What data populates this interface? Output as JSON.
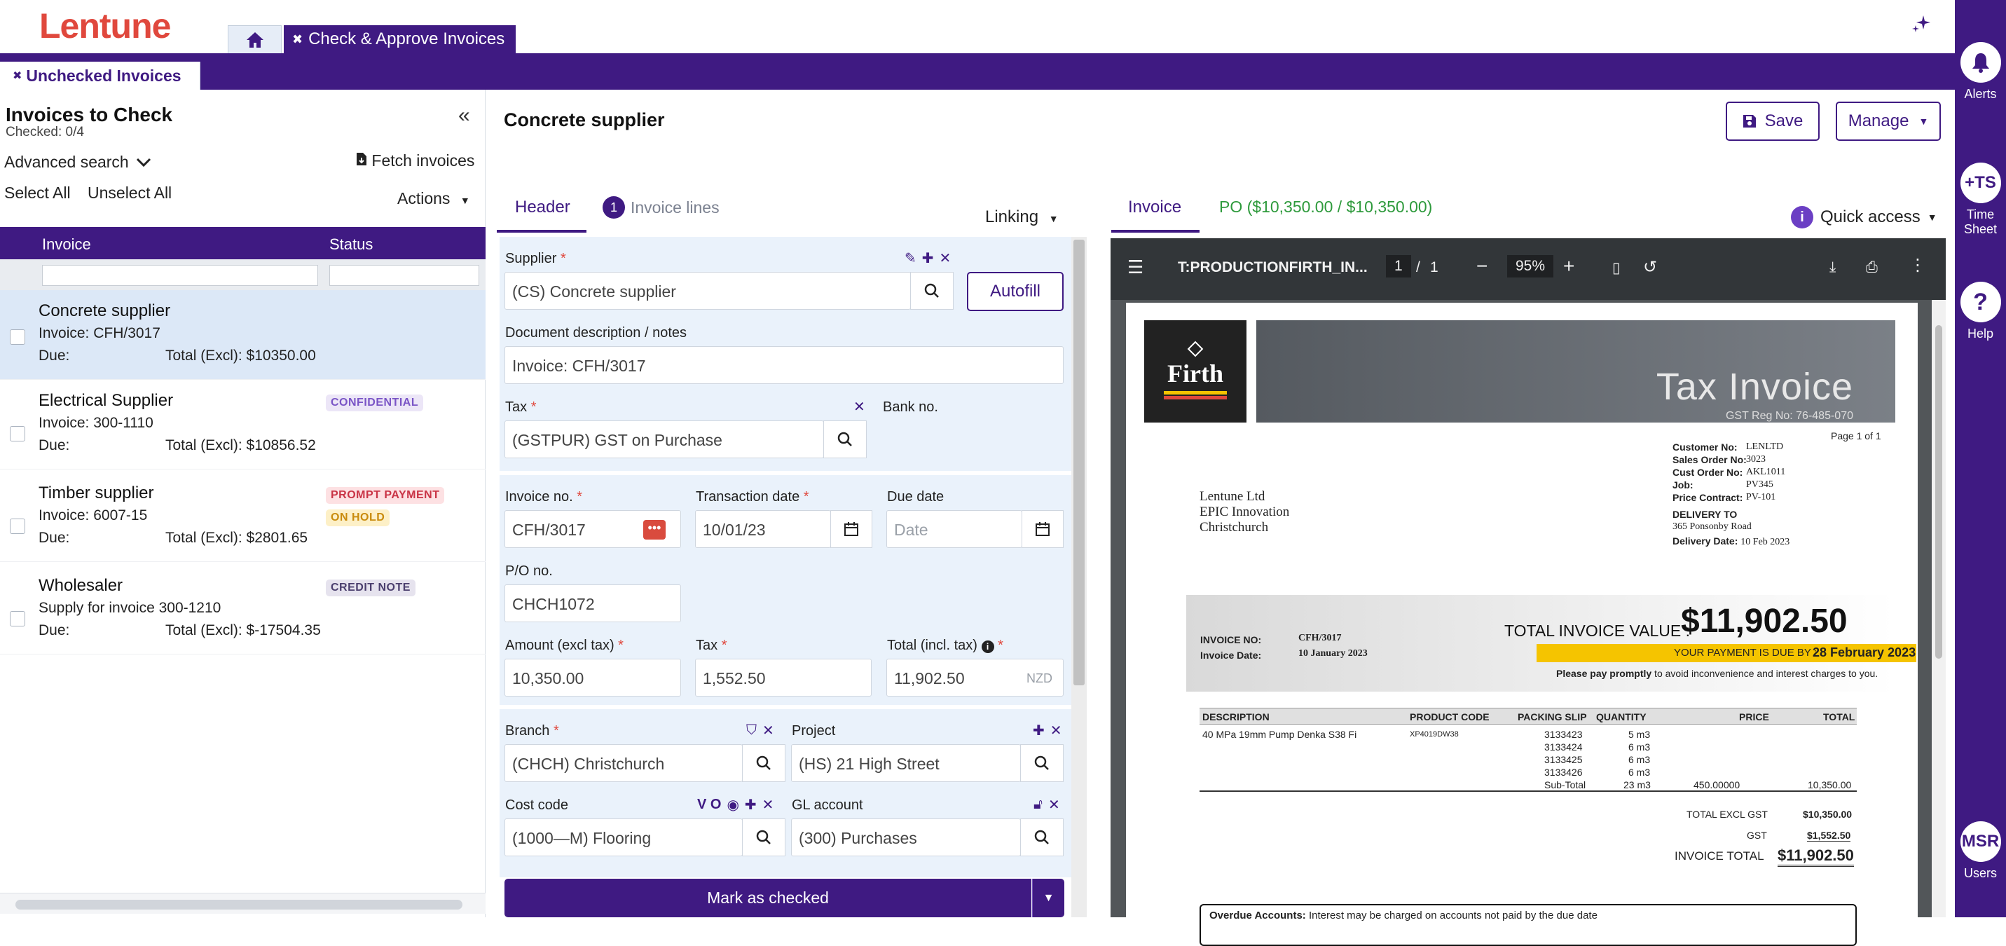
{
  "app": {
    "logo": "Lentune",
    "main_tab": "Check & Approve Invoices",
    "sub_tab": "Unchecked Invoices"
  },
  "rail": {
    "alerts": "Alerts",
    "timesheet_icon": "+TS",
    "timesheet_l1": "Time",
    "timesheet_l2": "Sheet",
    "help": "Help",
    "users_icon": "MSR",
    "users": "Users"
  },
  "left": {
    "title": "Invoices to Check",
    "checked": "Checked: 0/4",
    "advanced_search": "Advanced search",
    "fetch": "Fetch invoices",
    "select_all": "Select All",
    "unselect_all": "Unselect All",
    "actions": "Actions",
    "col_invoice": "Invoice",
    "col_status": "Status",
    "items": [
      {
        "name": "Concrete supplier",
        "invoice": "Invoice: CFH/3017",
        "due": "Due:",
        "total": "Total (Excl): $10350.00",
        "badges": []
      },
      {
        "name": "Electrical Supplier",
        "invoice": "Invoice: 300-1110",
        "due": "Due:",
        "total": "Total (Excl): $10856.52",
        "badges": [
          "CONFIDENTIAL"
        ]
      },
      {
        "name": "Timber supplier",
        "invoice": "Invoice: 6007-15",
        "due": "Due:",
        "total": "Total (Excl): $2801.65",
        "badges": [
          "PROMPT PAYMENT",
          "ON HOLD"
        ]
      },
      {
        "name": "Wholesaler",
        "invoice": "Supply for invoice 300-1210",
        "due": "Due:",
        "total": "Total (Excl): $-17504.35",
        "badges": [
          "CREDIT NOTE"
        ]
      }
    ]
  },
  "mid": {
    "title": "Concrete supplier",
    "tab_header": "Header",
    "tab_lines_count": "1",
    "tab_lines": "Invoice lines",
    "linking": "Linking",
    "supplier_label": "Supplier",
    "supplier_value": "(CS) Concrete supplier",
    "autofill": "Autofill",
    "desc_label": "Document description / notes",
    "desc_value": "Invoice: CFH/3017",
    "tax_label": "Tax",
    "tax_value": "(GSTPUR) GST on Purchase",
    "bank_label": "Bank no.",
    "invno_label": "Invoice no.",
    "invno_value": "CFH/3017",
    "trans_label": "Transaction date",
    "trans_value": "10/01/23",
    "due_label": "Due date",
    "due_placeholder": "Date",
    "po_label": "P/O no.",
    "po_value": "CHCH1072",
    "amount_label": "Amount (excl tax)",
    "amount_value": "10,350.00",
    "taxamt_label": "Tax",
    "taxamt_value": "1,552.50",
    "total_label": "Total (incl. tax)",
    "total_value": "11,902.50",
    "currency": "NZD",
    "branch_label": "Branch",
    "branch_value": "(CHCH) Christchurch",
    "project_label": "Project",
    "project_value": "(HS) 21 High Street",
    "cost_label": "Cost code",
    "cost_value": "(1000—M) Flooring",
    "cost_icons": "V O",
    "gl_label": "GL account",
    "gl_value": "(300) Purchases",
    "mark": "Mark as checked"
  },
  "doc": {
    "save": "Save",
    "manage": "Manage",
    "tab_invoice": "Invoice",
    "tab_po": "PO ($10,350.00 / $10,350.00)",
    "quick": "Quick access",
    "viewer_title": "T:PRODUCTIONFIRTH_IN...",
    "page_cur": "1",
    "page_sep": "/",
    "page_total": "1",
    "zoom": "95%",
    "inv": {
      "logo": "Firth",
      "title": "Tax Invoice",
      "gst_reg": "GST Reg No: 76-485-070",
      "page_of": "Page 1 of 1",
      "cust_no_l": "Customer No:",
      "cust_no": "LENLTD",
      "so_l": "Sales Order No:",
      "so": "3023",
      "co_l": "Cust Order No:",
      "co": "AKL1011",
      "job_l": "Job:",
      "job": "PV345",
      "pc_l": "Price Contract:",
      "pc": "PV-101",
      "delivery_to": "DELIVERY TO",
      "delivery_addr": "365 Ponsonby Road",
      "delivery_date_l": "Delivery Date:",
      "delivery_date": "10 Feb 2023",
      "addr1": "Lentune Ltd",
      "addr2": "EPIC Innovation",
      "addr3": "Christchurch",
      "inv_no_l": "INVOICE NO:",
      "inv_no": "CFH/3017",
      "inv_date_l": "Invoice Date:",
      "inv_date": "10 January 2023",
      "tiv_l": "TOTAL INVOICE VALUE :",
      "tiv": "$11,902.50",
      "due_by_l": "YOUR PAYMENT IS DUE BY :",
      "due_by": "28 February 2023",
      "pay_note_b": "Please pay promptly",
      "pay_note": " to avoid inconvenience and interest charges to you.",
      "th_desc": "DESCRIPTION",
      "th_code": "PRODUCT CODE",
      "th_slip": "PACKING SLIP",
      "th_qty": "QUANTITY",
      "th_price": "PRICE",
      "th_total": "TOTAL",
      "line_desc": "40 MPa 19mm Pump Denka S38 Fi",
      "line_code": "XP4019DW38",
      "slips": [
        "3133423",
        "3133424",
        "3133425",
        "3133426"
      ],
      "qtys": [
        "5 m3",
        "6 m3",
        "6 m3",
        "6 m3"
      ],
      "subtotal_l": "Sub-Total",
      "subtotal_qty": "23 m3",
      "line_price": "450.00000",
      "line_total": "10,350.00",
      "excl_l": "TOTAL EXCL GST",
      "excl": "$10,350.00",
      "gst_l": "GST",
      "gst": "$1,552.50",
      "total_l": "INVOICE TOTAL",
      "total": "$11,902.50",
      "overdue_b": "Overdue Accounts:",
      "overdue": " Interest may be charged on accounts not paid by the due date"
    }
  }
}
